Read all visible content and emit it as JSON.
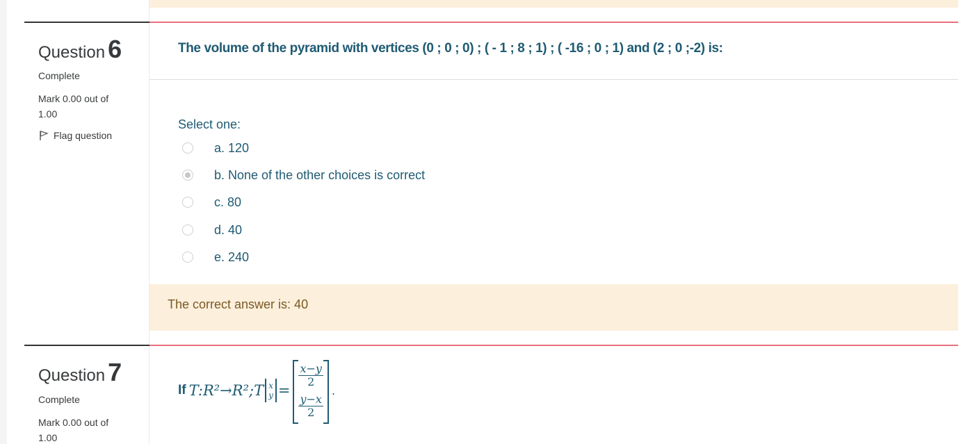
{
  "questions": [
    {
      "label": "Question",
      "number": "6",
      "state": "Complete",
      "grade": "Mark 0.00 out of 1.00",
      "flag_label": "Flag question",
      "text": "The volume of the pyramid with vertices (0 ; 0 ; 0) ; ( - 1 ; 8 ; 1) ; ( -16 ; 0 ; 1) and (2 ; 0 ;-2) is:",
      "prompt": "Select one:",
      "options": [
        {
          "label": "a. 120",
          "checked": false
        },
        {
          "label": "b. None of the other choices is correct",
          "checked": true
        },
        {
          "label": "c. 80",
          "checked": false
        },
        {
          "label": "d. 40",
          "checked": false
        },
        {
          "label": "e. 240",
          "checked": false
        }
      ],
      "feedback": "The correct answer is: 40"
    },
    {
      "label": "Question",
      "number": "7",
      "state": "Complete",
      "grade": "Mark 0.00 out of 1.00",
      "math": {
        "if_word": "If",
        "lhs": "T:R²→R²;T",
        "vec_top": "x",
        "vec_bottom": "y",
        "equals": "=",
        "row1_num": "x−y",
        "row1_den": "2",
        "row2_num": "y−x",
        "row2_den": "2",
        "period": "."
      }
    }
  ],
  "colors": {
    "question_text": "#1f5b73",
    "accent_rule": "#e8707c",
    "feedback_bg": "#fcefdc",
    "feedback_text": "#7a5a24"
  }
}
